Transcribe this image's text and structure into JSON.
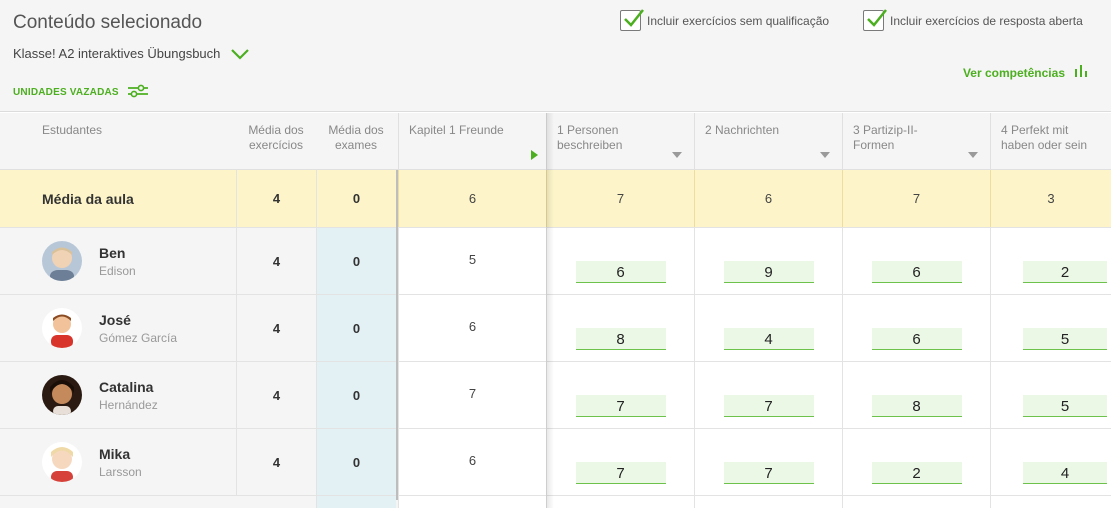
{
  "header": {
    "title": "Conteúdo selecionado",
    "book": "Klasse! A2 interaktives Übungsbuch",
    "units_label": "UNIDADES VAZADAS",
    "option1": "Incluir exercícios sem qualificação",
    "option2": "Incluir exercícios de resposta aberta",
    "option1_checked": true,
    "option2_checked": true,
    "competencias": "Ver competências",
    "accent": "#4caf1f"
  },
  "columns": {
    "students": "Estudantes",
    "ex": "Média dos exercícios",
    "exam": "Média dos exames",
    "k1": "Kapitel 1 Freunde",
    "c1": "1 Personen beschreiben",
    "c2": "2 Nachrichten",
    "c3": "3 Partizip-II-Formen",
    "c4": "4 Perfekt mit haben oder sein"
  },
  "average": {
    "label": "Média da aula",
    "ex": "4",
    "exam": "0",
    "k1": "6",
    "c1": "7",
    "c2": "6",
    "c3": "7",
    "c4": "3"
  },
  "students": [
    {
      "first": "Ben",
      "last": "Edison",
      "ex": "4",
      "exam": "0",
      "k1": "5",
      "c1": "6",
      "c2": "9",
      "c3": "6",
      "c4": "2"
    },
    {
      "first": "José",
      "last": "Gómez García",
      "ex": "4",
      "exam": "0",
      "k1": "6",
      "c1": "8",
      "c2": "4",
      "c3": "6",
      "c4": "5"
    },
    {
      "first": "Catalina",
      "last": "Hernández",
      "ex": "4",
      "exam": "0",
      "k1": "7",
      "c1": "7",
      "c2": "7",
      "c3": "8",
      "c4": "5"
    },
    {
      "first": "Mika",
      "last": "Larsson",
      "ex": "4",
      "exam": "0",
      "k1": "6",
      "c1": "7",
      "c2": "7",
      "c3": "2",
      "c4": "4"
    }
  ]
}
